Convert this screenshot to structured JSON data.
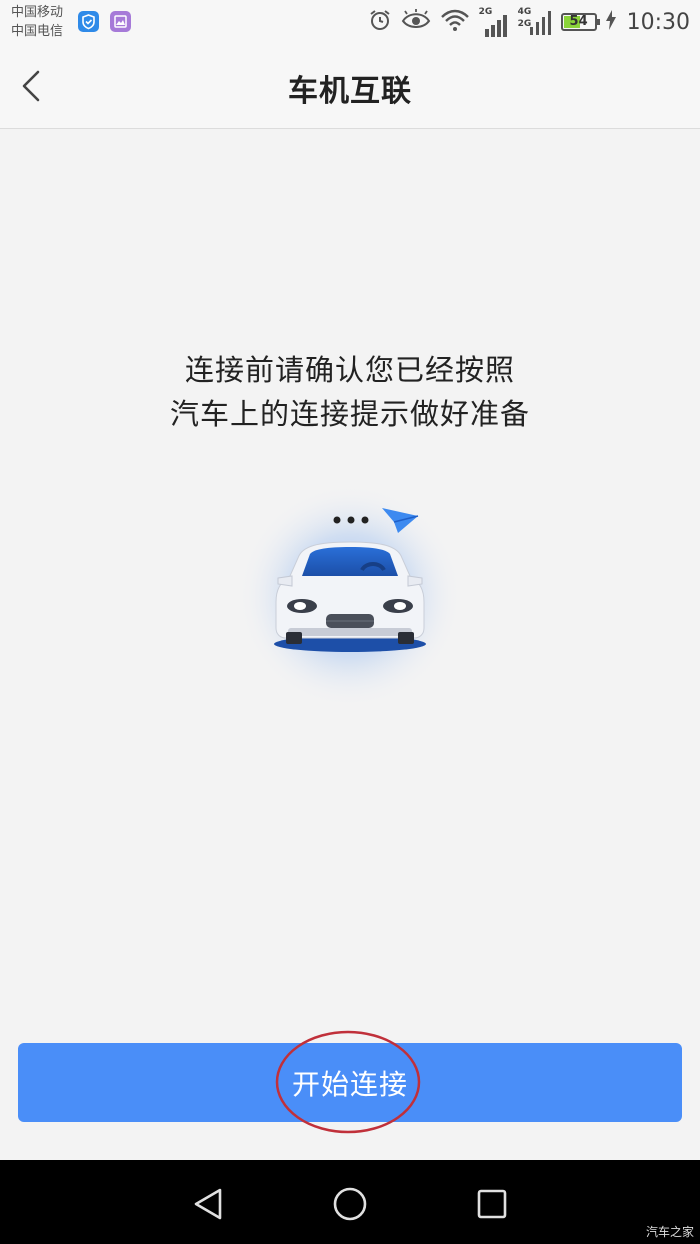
{
  "status_bar": {
    "carrier_1": "中国移动",
    "carrier_2": "中国电信",
    "network_1": "2G",
    "network_2a": "4G",
    "network_2b": "2G",
    "battery_level": 54,
    "battery_text": "54",
    "time": "10:30",
    "icons": [
      "shield-app-icon",
      "photo-app-icon",
      "alarm-icon",
      "eye-icon",
      "wifi-icon",
      "signal-icon",
      "signal-icon",
      "battery-icon",
      "charging-icon"
    ]
  },
  "header": {
    "back_icon": "chevron-left-icon",
    "title": "车机互联"
  },
  "main": {
    "message_line_1": "连接前请确认您已经按照",
    "message_line_2": "汽车上的连接提示做好准备",
    "illustration": "car-connect-icon"
  },
  "action": {
    "button_label": "开始连接"
  },
  "nav_bar": {
    "icons": [
      "nav-back-icon",
      "nav-home-icon",
      "nav-recent-icon"
    ]
  },
  "watermark": "汽车之家",
  "colors": {
    "accent": "#4a8ef8",
    "background": "#f3f3f3",
    "highlight_ring": "#c0303a"
  }
}
